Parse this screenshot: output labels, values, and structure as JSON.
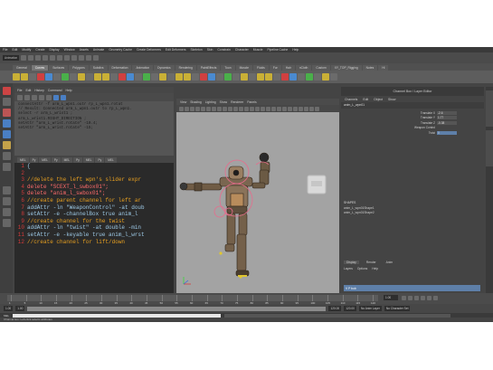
{
  "app": {
    "menubar": [
      "File",
      "Edit",
      "Modify",
      "Create",
      "Display",
      "Window",
      "Assets",
      "Animate",
      "Geometry Cache",
      "Create Deformers",
      "Edit Deformers",
      "Skeleton",
      "Skin",
      "Constrain",
      "Character",
      "Muscle",
      "Pipeline Cache",
      "Help"
    ],
    "mode_field": "Animation",
    "shelf_tabs": [
      "General",
      "Curves",
      "Surfaces",
      "Polygons",
      "Subdivs",
      "Deformation",
      "Animation",
      "Dynamics",
      "Rendering",
      "PaintEffects",
      "Toon",
      "Muscle",
      "Fluids",
      "Fur",
      "Hair",
      "nCloth",
      "Custom",
      "XY_TOP_Rigging",
      "Notes",
      "Hi"
    ],
    "active_shelf_tab": "Curves"
  },
  "script_editor": {
    "menu": [
      "File",
      "Edit",
      "History",
      "Command",
      "Help"
    ],
    "history": [
      "connectAttr -f arm_L_wpn1.outr rp_L_wpn1.rotat",
      "// Result: Connected arm_L_wpn1.outr to rp_L_wpn1.",
      "select -r arm_L_wrist1 ;",
      "arm_L_wrist1.RIGHT_DIRECTION ;",
      "setAttr \"arm_L_wrist.rotate\" -10.4;",
      "setAttr \"arm_L_wrist.rotate\" -15;"
    ],
    "tabs": [
      "MEL",
      "Py",
      "MEL",
      "Py",
      "MEL",
      "Py",
      "MEL",
      "Py",
      "MEL"
    ],
    "code_lines": [
      {
        "n": "1",
        "t": "{"
      },
      {
        "n": "2",
        "t": ""
      },
      {
        "n": "3",
        "t": "//delete the left wpn's slider expr"
      },
      {
        "n": "4",
        "t": "delete \"SCEXT_l_swbox01\";"
      },
      {
        "n": "5",
        "t": "delete \"anim_l_swbox01\";"
      },
      {
        "n": "6",
        "t": "//create parent channel for left ar"
      },
      {
        "n": "7",
        "t": "addAttr -ln \"WeaponControl\" -at doub"
      },
      {
        "n": "8",
        "t": "setAttr -e -channelBox true anim_l"
      },
      {
        "n": "9",
        "t": "//create channel for the twist"
      },
      {
        "n": "10",
        "t": "addAttr -ln \"twist\" -at double -min"
      },
      {
        "n": "11",
        "t": "setAttr -e -keyable true anim_l_wrst"
      },
      {
        "n": "12",
        "t": "//create channel for lift/down"
      }
    ]
  },
  "viewport": {
    "menu": [
      "View",
      "Shading",
      "Lighting",
      "Show",
      "Renderer",
      "Panels"
    ]
  },
  "channel_box": {
    "title": "Channel Box / Layer Editor",
    "menu": [
      "Channels",
      "Edit",
      "Object",
      "Show"
    ],
    "object": "anim_L_wpn01",
    "attributes": [
      {
        "name": "Translate X",
        "value": "-2.6"
      },
      {
        "name": "Translate Y",
        "value": "1.77"
      },
      {
        "name": "Translate Z",
        "value": "-0.38"
      },
      {
        "name": "Weapon Control",
        "value": ""
      },
      {
        "name": "Twist",
        "value": "0"
      }
    ],
    "shapes_label": "SHAPES",
    "shapes": [
      "anim_L_wpn01Shape1",
      "anim_L_wpn01Shape2"
    ],
    "layer_tabs": [
      "Display",
      "Render",
      "Anim"
    ],
    "layer_menu": [
      "Layers",
      "Options",
      "Help"
    ],
    "layer_name": "V  P  bob"
  },
  "timeline": {
    "labels": [
      "1",
      "5",
      "10",
      "15",
      "20",
      "25",
      "30",
      "35",
      "40",
      "45",
      "50",
      "55",
      "60",
      "65",
      "70",
      "75",
      "80",
      "85",
      "90",
      "95",
      "100",
      "105",
      "110",
      "115",
      "120"
    ],
    "current_frame": "1.00"
  },
  "range": {
    "start": "1.00",
    "start2": "1.00",
    "end": "120.00",
    "end2": "120.00",
    "anim_layer": "No Anim Layer",
    "char_set": "No Character Set"
  },
  "cmdline": {
    "label": "MEL"
  },
  "help_line": "Channel box: Left-click selects attributes"
}
